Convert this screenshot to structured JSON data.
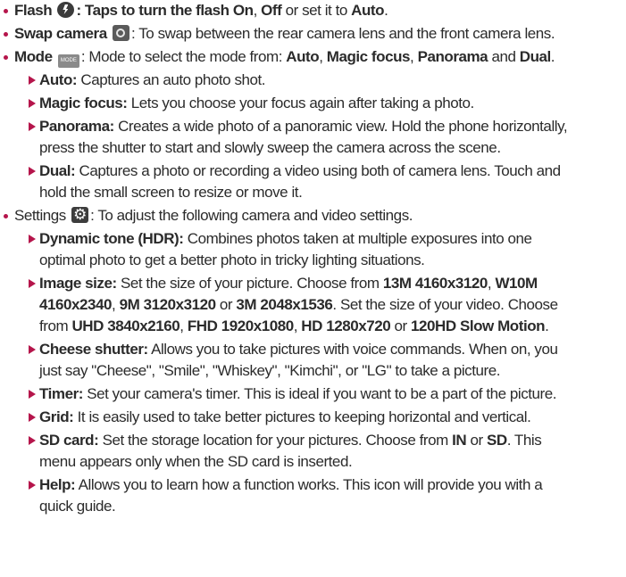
{
  "items": [
    {
      "label": "Flash",
      "desc": ": Taps to turn the flash ",
      "on": "On",
      "sep1": ", ",
      "off": "Off",
      "mid": " or set it to ",
      "auto": "Auto",
      "end": ".",
      "icon": "flash-icon"
    },
    {
      "label": "Swap camera",
      "desc": ": To swap between the rear camera lens and the front camera lens.",
      "icon": "swap-camera-icon"
    },
    {
      "label": "Mode",
      "desc": ": Mode to select the mode from: ",
      "m1": "Auto",
      "s1": ", ",
      "m2": "Magic focus",
      "s2": ", ",
      "m3": "Panorama",
      "s3": " and ",
      "m4": "Dual",
      "end": ".",
      "icon": "mode-icon",
      "icon_text": "MODE"
    },
    {
      "label": "Settings",
      "desc": ": To adjust the following camera and video settings.",
      "icon": "gear-icon"
    }
  ],
  "mode_sub": [
    {
      "title": "Auto:",
      "lines": [
        " Captures an auto photo shot."
      ]
    },
    {
      "title": "Magic focus:",
      "lines": [
        " Lets you choose your focus again after taking a photo."
      ]
    },
    {
      "title": "Panorama:",
      "lines": [
        " Creates a wide photo of a panoramic view. Hold the phone horizontally,",
        "press the shutter to start and slowly sweep the camera across the scene."
      ]
    },
    {
      "title": "Dual:",
      "lines": [
        " Captures a photo or recording a video using both of camera lens. Touch and",
        "hold the small screen to resize or move it."
      ]
    }
  ],
  "settings_sub": {
    "hdr": {
      "title": "Dynamic tone (HDR):",
      "l1": " Combines photos taken at multiple exposures into one",
      "l2": "optimal photo to get a better photo in tricky lighting situations."
    },
    "size": {
      "title": "Image size:",
      "t1": " Set the size of your picture. Choose from ",
      "v1": "13M 4160x3120",
      "t2": ", ",
      "v2": "W10M",
      "v2b": "4160x2340",
      "t3": ", ",
      "v3": "9M 3120x3120",
      "t4": " or ",
      "v4": "3M 2048x1536",
      "t5": ". Set the size of your video. Choose",
      "t6": "from ",
      "v5": "UHD 3840x2160",
      "t7": ", ",
      "v6": "FHD 1920x1080",
      "t8": ", ",
      "v7": "HD 1280x720",
      "t9": " or ",
      "v8": "120HD Slow Motion",
      "t10": "."
    },
    "cheese": {
      "title": "Cheese shutter:",
      "l1": " Allows you to take pictures with voice commands. When on, you",
      "l2": "just say \"Cheese\", \"Smile\", \"Whiskey\", \"Kimchi\", or \"LG\" to take a picture."
    },
    "timer": {
      "title": "Timer:",
      "l1": " Set your camera's timer. This is ideal if you want to be a part of the picture."
    },
    "grid": {
      "title": "Grid:",
      "l1": " It is easily used to take better pictures to keeping horizontal and vertical."
    },
    "sd": {
      "title": "SD card:",
      "l1": " Set the storage location for your pictures. Choose from ",
      "in": "IN",
      "or": " or ",
      "sdv": "SD",
      "l1e": ". This",
      "l2": "menu appears only when the SD card is inserted."
    },
    "help": {
      "title": "Help:",
      "l1": " Allows you to learn how a function works. This icon will provide you with a",
      "l2": "quick guide."
    }
  },
  "colors": {
    "bullet": "#b5154b",
    "text": "#2b2b2b"
  }
}
